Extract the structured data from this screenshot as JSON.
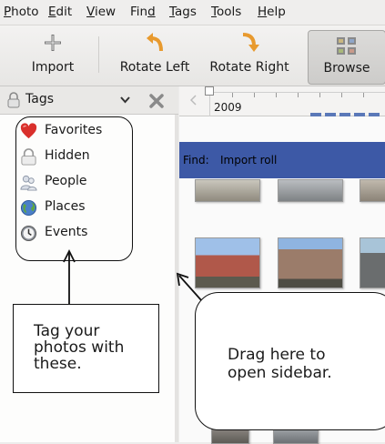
{
  "menu": [
    {
      "label": "Photo",
      "accel": "P",
      "rest": "hoto"
    },
    {
      "label": "Edit",
      "accel": "E",
      "rest": "dit"
    },
    {
      "label": "View",
      "accel": "V",
      "rest": "iew"
    },
    {
      "label": "Find",
      "pre": "Fin",
      "accel": "d",
      "rest": ""
    },
    {
      "label": "Tags",
      "accel": "T",
      "rest": "ags"
    },
    {
      "label": "Tools",
      "accel": "T",
      "rest": "ools"
    },
    {
      "label": "Help",
      "accel": "H",
      "rest": "elp"
    }
  ],
  "toolbar": {
    "import_label": "Import",
    "rotate_left_label": "Rotate Left",
    "rotate_right_label": "Rotate Right",
    "browse_label": "Browse"
  },
  "sidebar": {
    "selector_label": "Tags",
    "items": [
      {
        "label": "Favorites",
        "icon": "heart-icon"
      },
      {
        "label": "Hidden",
        "icon": "lock-icon"
      },
      {
        "label": "People",
        "icon": "people-icon"
      },
      {
        "label": "Places",
        "icon": "globe-icon"
      },
      {
        "label": "Events",
        "icon": "clock-icon"
      }
    ]
  },
  "timeline": {
    "year": "2009"
  },
  "find_bar": {
    "label": "Find:",
    "term": "Import roll"
  },
  "annotations": {
    "tag_note": [
      "Tag your",
      "photos with",
      "these."
    ],
    "drag_note": [
      "Drag here to",
      "open sidebar."
    ]
  },
  "colors": {
    "find_bar": "#3d59a6",
    "heart": "#d9302c",
    "rotate_arrow": "#f0a030"
  }
}
